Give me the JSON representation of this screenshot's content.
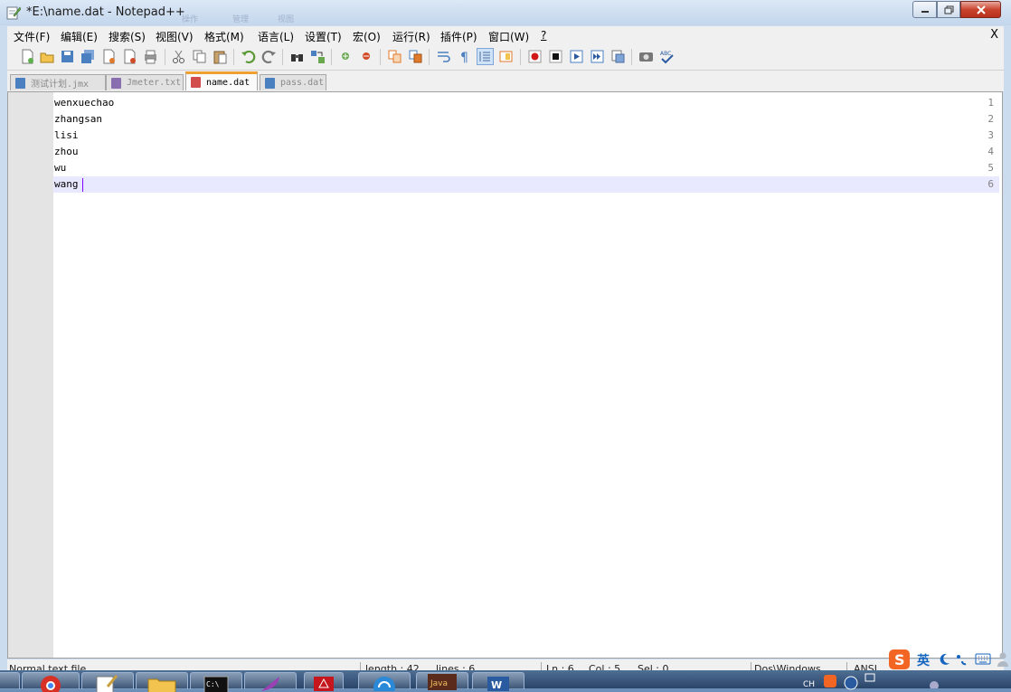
{
  "window": {
    "title": "*E:\\name.dat - Notepad++",
    "ghost_text": [
      "操作",
      "管理",
      "视图"
    ]
  },
  "menu": {
    "items": [
      "文件(F)",
      "编辑(E)",
      "搜索(S)",
      "视图(V)",
      "格式(M)",
      "语言(L)",
      "设置(T)",
      "宏(O)",
      "运行(R)",
      "插件(P)",
      "窗口(W)",
      "?"
    ],
    "close": "X"
  },
  "toolbar": {
    "icons": [
      "new-file-icon",
      "open-file-icon",
      "save-icon",
      "save-all-icon",
      "close-icon",
      "close-all-icon",
      "print-icon",
      "cut-icon",
      "copy-icon",
      "paste-icon",
      "undo-icon",
      "redo-icon",
      "find-icon",
      "replace-icon",
      "zoom-in-icon",
      "zoom-out-icon",
      "sync-vertical-icon",
      "sync-horizontal-icon",
      "word-wrap-icon",
      "show-all-chars-icon",
      "indent-guide-icon",
      "doc-map-icon",
      "record-macro-icon",
      "stop-record-icon",
      "play-macro-icon",
      "run-macro-multiple-icon",
      "save-macro-icon",
      "launch-browser-icon",
      "spell-check-icon"
    ]
  },
  "tabs": [
    {
      "label": "测试计划.jmx",
      "state": "saved",
      "active": false
    },
    {
      "label": "Jmeter.txt",
      "state": "saved",
      "active": false
    },
    {
      "label": "name.dat",
      "state": "modified",
      "active": true
    },
    {
      "label": "pass.dat",
      "state": "saved",
      "active": false
    }
  ],
  "editor": {
    "lines": [
      "wenxuechao",
      "zhangsan",
      "lisi",
      "zhou",
      "wu",
      "wang"
    ],
    "line_numbers": [
      "1",
      "2",
      "3",
      "4",
      "5",
      "6"
    ],
    "current_line": 6,
    "caret_column": 5
  },
  "statusbar": {
    "file_type": "Normal text file",
    "length": "length : 42",
    "lines": "lines : 6",
    "ln": "Ln : 6",
    "col": "Col : 5",
    "sel": "Sel : 0",
    "eol": "Dos\\Windows",
    "encoding": "ANSI"
  },
  "ime": {
    "lang": "英"
  },
  "colors": {
    "current_line": "#e8e8ff",
    "caret": "#8000ff",
    "active_tab_accent": "#f0a030",
    "gutter": "#e4e4e4"
  }
}
